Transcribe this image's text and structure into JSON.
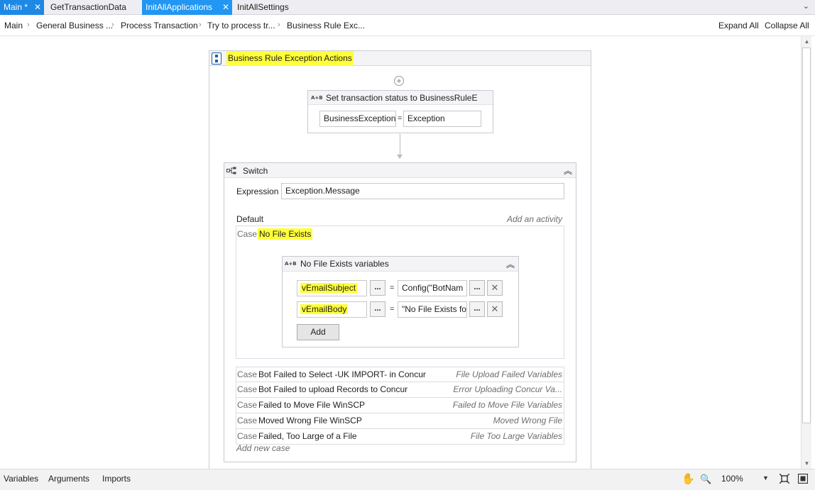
{
  "tabs": [
    {
      "label": "Main *",
      "active": true
    },
    {
      "label": "GetTransactionData"
    },
    {
      "label": "InitAllApplications",
      "active": true
    },
    {
      "label": "InitAllSettings"
    }
  ],
  "breadcrumb": {
    "items": [
      "Main",
      "General Business ...",
      "Process Transaction",
      "Try to process tr...",
      "Business Rule Exc..."
    ],
    "expand_all": "Expand All",
    "collapse_all": "Collapse All"
  },
  "sequence": {
    "title": "Business Rule Exception Actions",
    "assign": {
      "title": "Set transaction status to BusinessRuleE",
      "to": "BusinessException",
      "eq": "=",
      "value": "Exception"
    },
    "switch": {
      "title": "Switch",
      "expression_label": "Expression",
      "expression_value": "Exception.Message",
      "default_label": "Default",
      "add_activity": "Add an activity",
      "case_word": "Case",
      "case_expanded": {
        "name": "No File Exists",
        "activity_title": "No File Exists variables",
        "rows": [
          {
            "to": "vEmailSubject",
            "dots": "...",
            "eq": "=",
            "value": "Config(\"BotNam"
          },
          {
            "to": "vEmailBody",
            "dots": "...",
            "eq": "=",
            "value": "\"No File Exists fo"
          }
        ],
        "add_label": "Add"
      },
      "cases": [
        {
          "word": "Case",
          "name": "Bot Failed to Select -UK IMPORT- in Concur",
          "activity": "File Upload Failed Variables"
        },
        {
          "word": "Case",
          "name": "Bot Failed to upload Records to Concur",
          "activity": "Error Uploading Concur Va..."
        },
        {
          "word": "Case",
          "name": "Failed to Move File WinSCP",
          "activity": "Failed to Move File Variables"
        },
        {
          "word": "Case",
          "name": "Moved Wrong File WinSCP",
          "activity": "Moved Wrong File"
        },
        {
          "word": "Case",
          "name": "Failed, Too Large of a File",
          "activity": "File Too Large Variables"
        }
      ],
      "add_new_case": "Add new case"
    }
  },
  "statusbar": {
    "variables": "Variables",
    "arguments": "Arguments",
    "imports": "Imports",
    "zoom": "100%"
  },
  "icons": {
    "close": "✕",
    "plus": "+",
    "collapse": "︽",
    "hand": "✋",
    "magnifier": "🔍",
    "x": "✕"
  },
  "colors": {
    "highlight": "#ffff3a",
    "tab_active": "#1e88e5"
  }
}
